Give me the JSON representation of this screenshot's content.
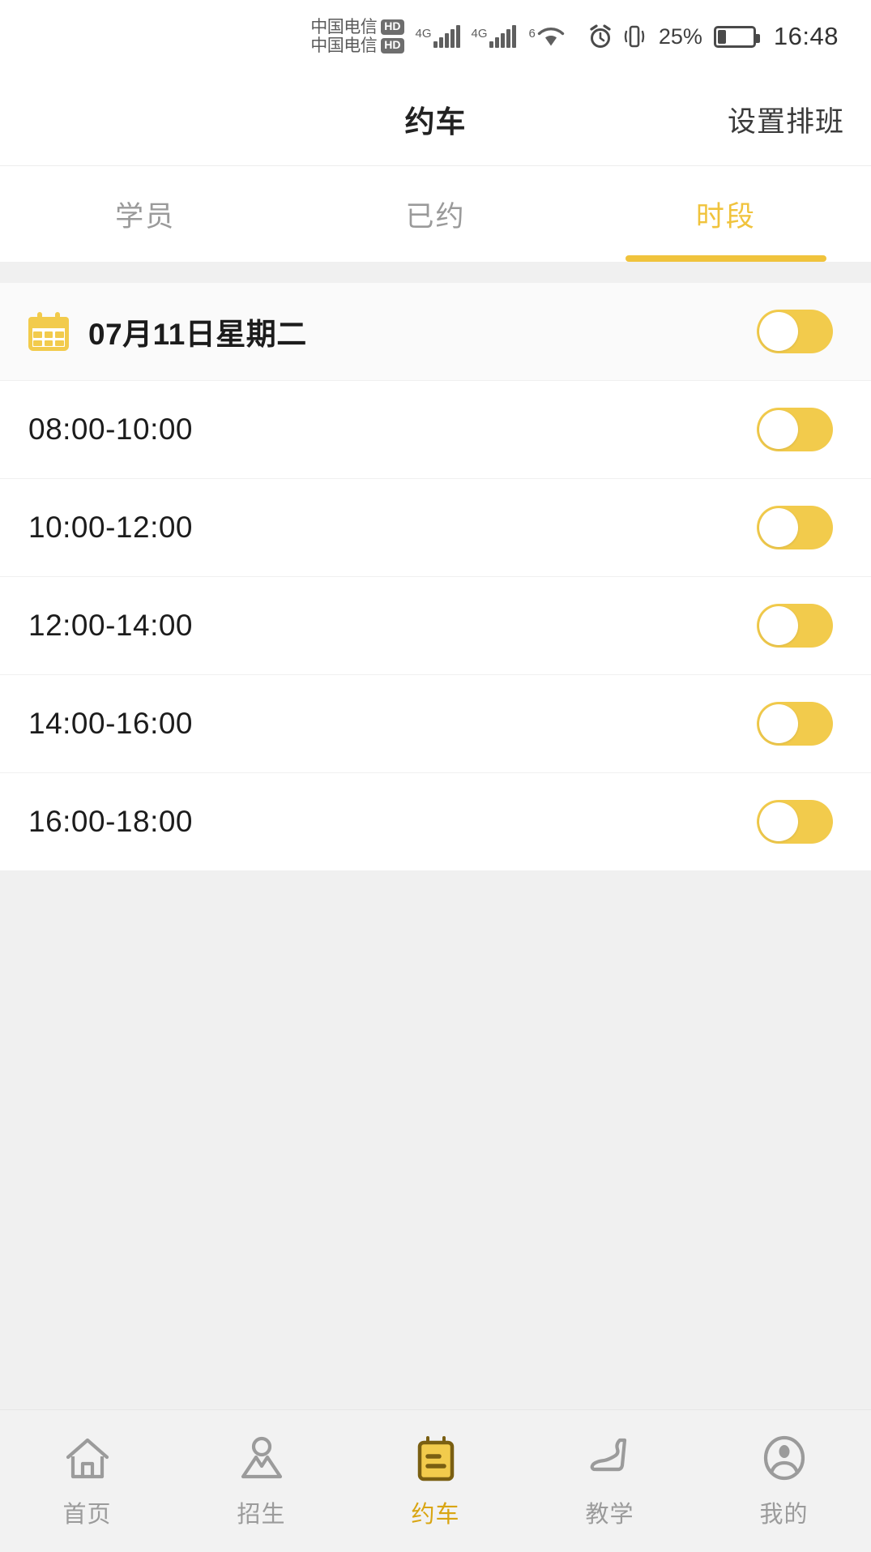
{
  "status_bar": {
    "carrier_line1": "中国电信",
    "carrier_line2": "中国电信",
    "hd_badge": "HD",
    "network_1": "4G",
    "network_2": "4G",
    "wifi_label": "6",
    "alarm_icon": "alarm-clock-icon",
    "vibrate_icon": "vibrate-icon",
    "battery_percent": "25%",
    "time": "16:48"
  },
  "header": {
    "title": "约车",
    "action_label": "设置排班"
  },
  "tabs": [
    {
      "label": "学员",
      "active": false
    },
    {
      "label": "已约",
      "active": false
    },
    {
      "label": "时段",
      "active": true
    }
  ],
  "schedule": {
    "date_label": "07月11日星期二",
    "date_icon": "calendar-icon",
    "date_toggle_on": true,
    "slots": [
      {
        "label": "08:00-10:00",
        "toggle_on": true
      },
      {
        "label": "10:00-12:00",
        "toggle_on": true
      },
      {
        "label": "12:00-14:00",
        "toggle_on": true
      },
      {
        "label": "14:00-16:00",
        "toggle_on": true
      },
      {
        "label": "16:00-18:00",
        "toggle_on": true
      }
    ]
  },
  "bottom_nav": [
    {
      "label": "首页",
      "icon": "home-icon",
      "active": false
    },
    {
      "label": "招生",
      "icon": "person-enroll-icon",
      "active": false
    },
    {
      "label": "约车",
      "icon": "notepad-booking-icon",
      "active": true
    },
    {
      "label": "教学",
      "icon": "car-seat-icon",
      "active": false
    },
    {
      "label": "我的",
      "icon": "profile-icon",
      "active": false
    }
  ],
  "colors": {
    "accent": "#f2cb4c",
    "accent_text": "#d9a512",
    "muted_text": "#9b9b9b",
    "page_bg": "#f0f0f0"
  }
}
